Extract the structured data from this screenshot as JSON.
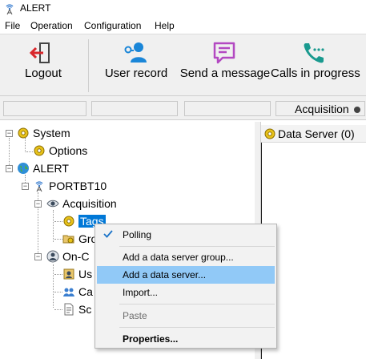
{
  "window": {
    "title": "ALERT"
  },
  "menubar": {
    "items": [
      "File",
      "Operation",
      "Configuration",
      "Help"
    ]
  },
  "toolbar": {
    "logout": "Logout",
    "user_record": "User record",
    "send_message": "Send a message",
    "calls_in_progress": "Calls in progress"
  },
  "statusbar": {
    "acquisition": "Acquisition",
    "acq_tail": "."
  },
  "right_pane": {
    "title": "Data Server (0)"
  },
  "tree": {
    "system": "System",
    "options": "Options",
    "alert": "ALERT",
    "portbt10": "PORTBT10",
    "acquisition": "Acquisition",
    "tags": "Tags",
    "groups": "Gro",
    "on_call": "On-C",
    "users": "Us",
    "calendars": "Ca",
    "schedules": "Sc"
  },
  "context_menu": {
    "polling": "Polling",
    "add_group": "Add a data server group...",
    "add_server": "Add a data server...",
    "import": "Import...",
    "paste": "Paste",
    "properties": "Properties..."
  },
  "colors": {
    "selection": "#0078d7",
    "menu_highlight": "#91c9f7",
    "logout_red": "#d9262b",
    "user_blue": "#1a86d8",
    "message_purple": "#b349c2",
    "calls_teal": "#1a9a8f"
  }
}
